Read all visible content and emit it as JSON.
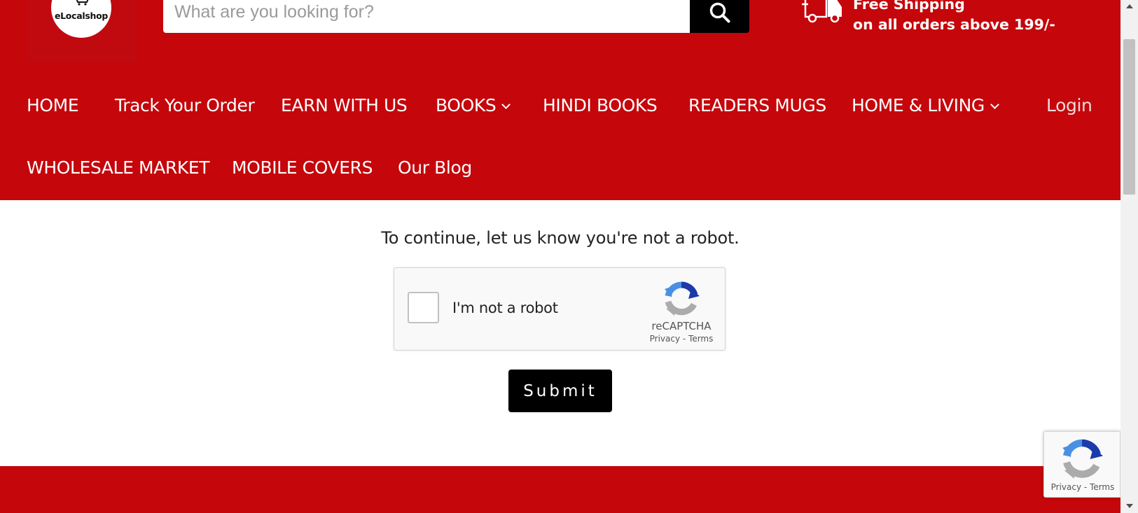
{
  "brand": {
    "logo_text": "eLocalshop"
  },
  "search": {
    "placeholder": "What are you looking for?"
  },
  "shipping": {
    "line1": "Free Shipping",
    "line2": "on all orders above 199/-"
  },
  "nav": {
    "row1": [
      {
        "label": "HOME"
      },
      {
        "label": "Track Your Order"
      },
      {
        "label": "EARN WITH US"
      },
      {
        "label": "BOOKS"
      },
      {
        "label": "HINDI BOOKS"
      },
      {
        "label": "READERS MUGS"
      },
      {
        "label": "HOME & LIVING"
      },
      {
        "label": "Login"
      }
    ],
    "row2": [
      {
        "label": "WHOLESALE MARKET"
      },
      {
        "label": "MOBILE COVERS"
      },
      {
        "label": "Our Blog"
      }
    ]
  },
  "captcha": {
    "notice": "To continue, let us know you're not a robot.",
    "checkbox_label": "I'm not a robot",
    "brand": "reCAPTCHA",
    "privacy": "Privacy",
    "separator": " - ",
    "terms": "Terms",
    "checked": false
  },
  "submit_label": "Submit",
  "badge": {
    "privacy": "Privacy",
    "separator": " - ",
    "terms": "Terms"
  },
  "colors": {
    "brand_red": "#c5060b",
    "button_black": "#000000"
  }
}
